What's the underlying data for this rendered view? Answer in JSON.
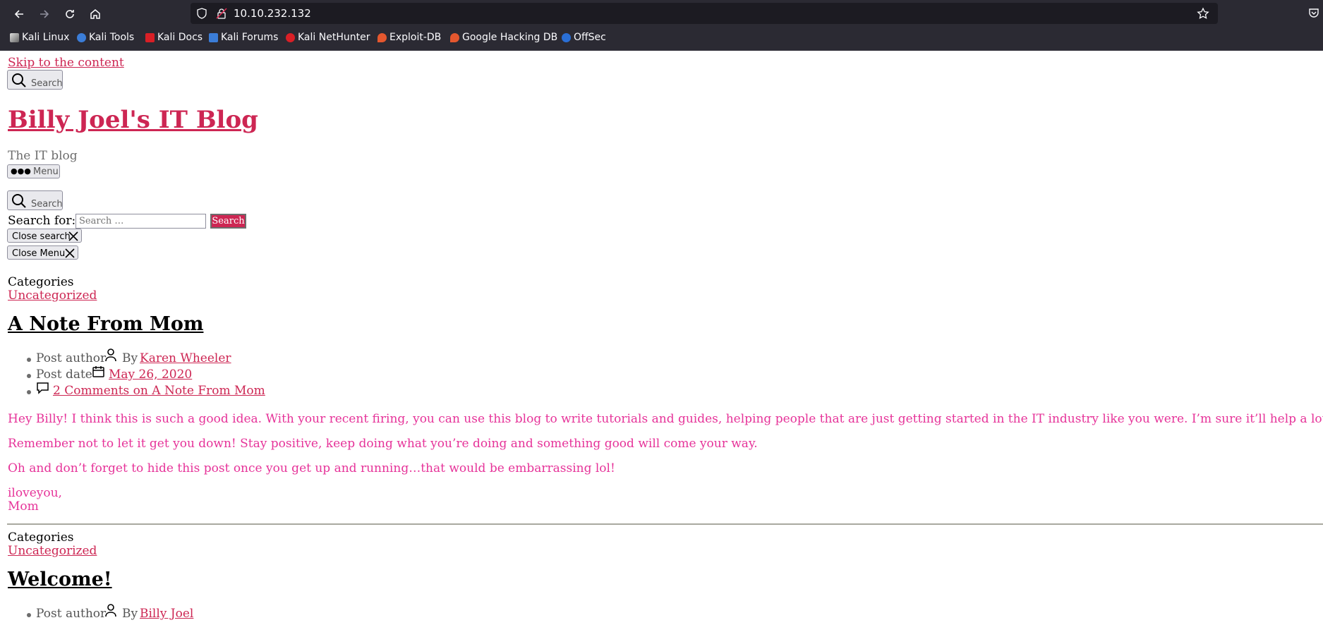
{
  "browser": {
    "url": "10.10.232.132",
    "bookmarks": [
      {
        "label": "Kali Linux",
        "icon": "kali-dragon-icon"
      },
      {
        "label": "Kali Tools",
        "icon": "kali-tools-icon"
      },
      {
        "label": "Kali Docs",
        "icon": "kali-docs-icon"
      },
      {
        "label": "Kali Forums",
        "icon": "kali-forums-icon"
      },
      {
        "label": "Kali NetHunter",
        "icon": "nethunter-icon"
      },
      {
        "label": "Exploit-DB",
        "icon": "exploitdb-icon"
      },
      {
        "label": "Google Hacking DB",
        "icon": "ghdb-icon"
      },
      {
        "label": "OffSec",
        "icon": "offsec-icon"
      }
    ]
  },
  "site": {
    "skip_link": "Skip to the content",
    "search_button": "Search",
    "title": "Billy Joel's IT Blog",
    "tagline": "The IT blog",
    "menu_button": "Menu",
    "search_label": "Search for:",
    "search_placeholder": "Search …",
    "search_submit": "Search",
    "close_search": "Close search",
    "close_menu": "Close Menu"
  },
  "posts": [
    {
      "categories_label": "Categories",
      "category": "Uncategorized",
      "title": "A Note From Mom",
      "author_label": "Post author",
      "by": "By",
      "author": "Karen Wheeler",
      "date_label": "Post date",
      "date": "May 26, 2020",
      "comments": "2 Comments on A Note From Mom",
      "paragraphs": [
        "Hey Billy!  I think this is such a good idea.  With your recent firing, you can use this blog to write tutorials and guides, helping people that are just getting started in the IT industry like you were.  I’m sure it’ll help a lot of people.",
        "Remember not to let it get you down!  Stay positive, keep doing what you’re doing and something good will come your way.",
        "Oh and don’t forget to hide this post once you get up and running…that would be embarrassing lol!"
      ],
      "signoff_1": "iloveyou,",
      "signoff_2": "Mom"
    },
    {
      "categories_label": "Categories",
      "category": "Uncategorized",
      "title": "Welcome!",
      "author_label": "Post author",
      "by": "By",
      "author": "Billy Joel"
    }
  ]
}
